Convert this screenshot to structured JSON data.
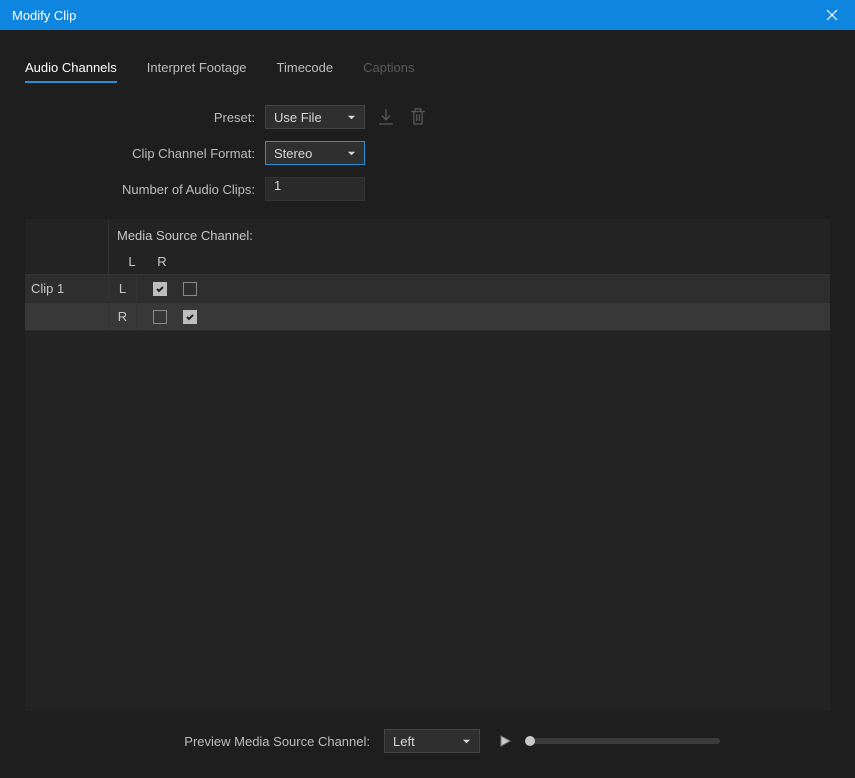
{
  "titlebar": {
    "title": "Modify Clip"
  },
  "tabs": {
    "audio_channels": "Audio Channels",
    "interpret_footage": "Interpret Footage",
    "timecode": "Timecode",
    "captions": "Captions"
  },
  "form": {
    "preset_label": "Preset:",
    "preset_value": "Use File",
    "format_label": "Clip Channel Format:",
    "format_value": "Stereo",
    "numclip_label": "Number of Audio Clips:",
    "numclip_value": "1"
  },
  "table": {
    "header": "Media Source Channel:",
    "l": "L",
    "r": "R",
    "clip1": "Clip 1"
  },
  "footer": {
    "label": "Preview Media Source Channel:",
    "value": "Left"
  }
}
